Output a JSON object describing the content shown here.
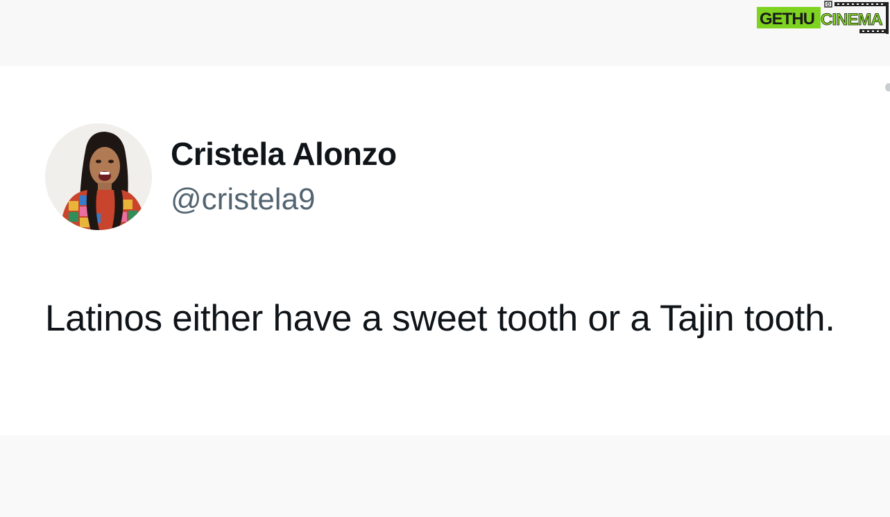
{
  "watermark": {
    "text_left": "GETHU",
    "text_right": "CINEMA",
    "color_left": "#7ed321",
    "color_right": "#7ed321"
  },
  "tweet": {
    "display_name": "Cristela Alonzo",
    "handle": "@cristela9",
    "text": "Latinos either have a sweet tooth or a Tajin tooth.",
    "avatar_icon": "profile-photo"
  },
  "colors": {
    "name": "#0f1419",
    "handle": "#536471",
    "text": "#0f1419",
    "background": "#ffffff"
  }
}
